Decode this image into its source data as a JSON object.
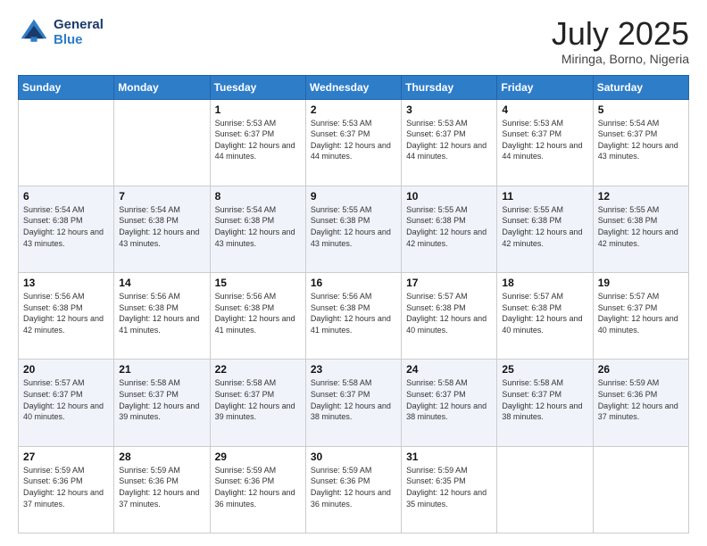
{
  "header": {
    "logo_line1": "General",
    "logo_line2": "Blue",
    "month_year": "July 2025",
    "location": "Miringa, Borno, Nigeria"
  },
  "days_of_week": [
    "Sunday",
    "Monday",
    "Tuesday",
    "Wednesday",
    "Thursday",
    "Friday",
    "Saturday"
  ],
  "weeks": [
    [
      {
        "day": "",
        "empty": true
      },
      {
        "day": "",
        "empty": true
      },
      {
        "day": "1",
        "sunrise": "Sunrise: 5:53 AM",
        "sunset": "Sunset: 6:37 PM",
        "daylight": "Daylight: 12 hours and 44 minutes."
      },
      {
        "day": "2",
        "sunrise": "Sunrise: 5:53 AM",
        "sunset": "Sunset: 6:37 PM",
        "daylight": "Daylight: 12 hours and 44 minutes."
      },
      {
        "day": "3",
        "sunrise": "Sunrise: 5:53 AM",
        "sunset": "Sunset: 6:37 PM",
        "daylight": "Daylight: 12 hours and 44 minutes."
      },
      {
        "day": "4",
        "sunrise": "Sunrise: 5:53 AM",
        "sunset": "Sunset: 6:37 PM",
        "daylight": "Daylight: 12 hours and 44 minutes."
      },
      {
        "day": "5",
        "sunrise": "Sunrise: 5:54 AM",
        "sunset": "Sunset: 6:37 PM",
        "daylight": "Daylight: 12 hours and 43 minutes."
      }
    ],
    [
      {
        "day": "6",
        "sunrise": "Sunrise: 5:54 AM",
        "sunset": "Sunset: 6:38 PM",
        "daylight": "Daylight: 12 hours and 43 minutes."
      },
      {
        "day": "7",
        "sunrise": "Sunrise: 5:54 AM",
        "sunset": "Sunset: 6:38 PM",
        "daylight": "Daylight: 12 hours and 43 minutes."
      },
      {
        "day": "8",
        "sunrise": "Sunrise: 5:54 AM",
        "sunset": "Sunset: 6:38 PM",
        "daylight": "Daylight: 12 hours and 43 minutes."
      },
      {
        "day": "9",
        "sunrise": "Sunrise: 5:55 AM",
        "sunset": "Sunset: 6:38 PM",
        "daylight": "Daylight: 12 hours and 43 minutes."
      },
      {
        "day": "10",
        "sunrise": "Sunrise: 5:55 AM",
        "sunset": "Sunset: 6:38 PM",
        "daylight": "Daylight: 12 hours and 42 minutes."
      },
      {
        "day": "11",
        "sunrise": "Sunrise: 5:55 AM",
        "sunset": "Sunset: 6:38 PM",
        "daylight": "Daylight: 12 hours and 42 minutes."
      },
      {
        "day": "12",
        "sunrise": "Sunrise: 5:55 AM",
        "sunset": "Sunset: 6:38 PM",
        "daylight": "Daylight: 12 hours and 42 minutes."
      }
    ],
    [
      {
        "day": "13",
        "sunrise": "Sunrise: 5:56 AM",
        "sunset": "Sunset: 6:38 PM",
        "daylight": "Daylight: 12 hours and 42 minutes."
      },
      {
        "day": "14",
        "sunrise": "Sunrise: 5:56 AM",
        "sunset": "Sunset: 6:38 PM",
        "daylight": "Daylight: 12 hours and 41 minutes."
      },
      {
        "day": "15",
        "sunrise": "Sunrise: 5:56 AM",
        "sunset": "Sunset: 6:38 PM",
        "daylight": "Daylight: 12 hours and 41 minutes."
      },
      {
        "day": "16",
        "sunrise": "Sunrise: 5:56 AM",
        "sunset": "Sunset: 6:38 PM",
        "daylight": "Daylight: 12 hours and 41 minutes."
      },
      {
        "day": "17",
        "sunrise": "Sunrise: 5:57 AM",
        "sunset": "Sunset: 6:38 PM",
        "daylight": "Daylight: 12 hours and 40 minutes."
      },
      {
        "day": "18",
        "sunrise": "Sunrise: 5:57 AM",
        "sunset": "Sunset: 6:38 PM",
        "daylight": "Daylight: 12 hours and 40 minutes."
      },
      {
        "day": "19",
        "sunrise": "Sunrise: 5:57 AM",
        "sunset": "Sunset: 6:37 PM",
        "daylight": "Daylight: 12 hours and 40 minutes."
      }
    ],
    [
      {
        "day": "20",
        "sunrise": "Sunrise: 5:57 AM",
        "sunset": "Sunset: 6:37 PM",
        "daylight": "Daylight: 12 hours and 40 minutes."
      },
      {
        "day": "21",
        "sunrise": "Sunrise: 5:58 AM",
        "sunset": "Sunset: 6:37 PM",
        "daylight": "Daylight: 12 hours and 39 minutes."
      },
      {
        "day": "22",
        "sunrise": "Sunrise: 5:58 AM",
        "sunset": "Sunset: 6:37 PM",
        "daylight": "Daylight: 12 hours and 39 minutes."
      },
      {
        "day": "23",
        "sunrise": "Sunrise: 5:58 AM",
        "sunset": "Sunset: 6:37 PM",
        "daylight": "Daylight: 12 hours and 38 minutes."
      },
      {
        "day": "24",
        "sunrise": "Sunrise: 5:58 AM",
        "sunset": "Sunset: 6:37 PM",
        "daylight": "Daylight: 12 hours and 38 minutes."
      },
      {
        "day": "25",
        "sunrise": "Sunrise: 5:58 AM",
        "sunset": "Sunset: 6:37 PM",
        "daylight": "Daylight: 12 hours and 38 minutes."
      },
      {
        "day": "26",
        "sunrise": "Sunrise: 5:59 AM",
        "sunset": "Sunset: 6:36 PM",
        "daylight": "Daylight: 12 hours and 37 minutes."
      }
    ],
    [
      {
        "day": "27",
        "sunrise": "Sunrise: 5:59 AM",
        "sunset": "Sunset: 6:36 PM",
        "daylight": "Daylight: 12 hours and 37 minutes."
      },
      {
        "day": "28",
        "sunrise": "Sunrise: 5:59 AM",
        "sunset": "Sunset: 6:36 PM",
        "daylight": "Daylight: 12 hours and 37 minutes."
      },
      {
        "day": "29",
        "sunrise": "Sunrise: 5:59 AM",
        "sunset": "Sunset: 6:36 PM",
        "daylight": "Daylight: 12 hours and 36 minutes."
      },
      {
        "day": "30",
        "sunrise": "Sunrise: 5:59 AM",
        "sunset": "Sunset: 6:36 PM",
        "daylight": "Daylight: 12 hours and 36 minutes."
      },
      {
        "day": "31",
        "sunrise": "Sunrise: 5:59 AM",
        "sunset": "Sunset: 6:35 PM",
        "daylight": "Daylight: 12 hours and 35 minutes."
      },
      {
        "day": "",
        "empty": true
      },
      {
        "day": "",
        "empty": true
      }
    ]
  ]
}
